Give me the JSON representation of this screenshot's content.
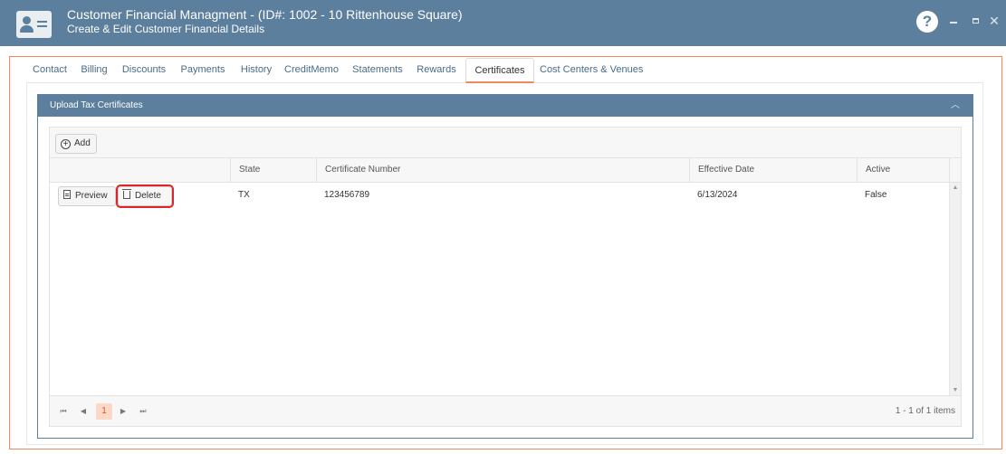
{
  "window": {
    "title": "Customer Financial Managment - (ID#: 1002 - 10 Rittenhouse Square)",
    "subtitle": "Create & Edit Customer Financial Details",
    "help_label": "?",
    "close_label": "✕"
  },
  "tabs": [
    {
      "label": "Contact"
    },
    {
      "label": "Billing"
    },
    {
      "label": "Discounts"
    },
    {
      "label": "Payments"
    },
    {
      "label": "History"
    },
    {
      "label": "CreditMemo"
    },
    {
      "label": "Statements"
    },
    {
      "label": "Rewards"
    },
    {
      "label": "Certificates",
      "active": true
    },
    {
      "label": "Cost Centers & Venues"
    }
  ],
  "panel": {
    "title": "Upload Tax Certificates",
    "collapse_icon": "chevron-up-icon"
  },
  "grid": {
    "toolbar": {
      "add_label": "Add"
    },
    "columns": [
      "",
      "State",
      "Certificate Number",
      "Effective Date",
      "Active"
    ],
    "rows": [
      {
        "preview_label": "Preview",
        "delete_label": "Delete",
        "state": "TX",
        "certificate_number": "123456789",
        "effective_date": "6/13/2024",
        "active": "False"
      }
    ],
    "pager": {
      "current_page": "1",
      "info": "1 - 1 of 1 items"
    }
  },
  "colors": {
    "header_bg": "#5b7f9c",
    "accent": "#f08a5d",
    "highlight": "#e0222a"
  }
}
